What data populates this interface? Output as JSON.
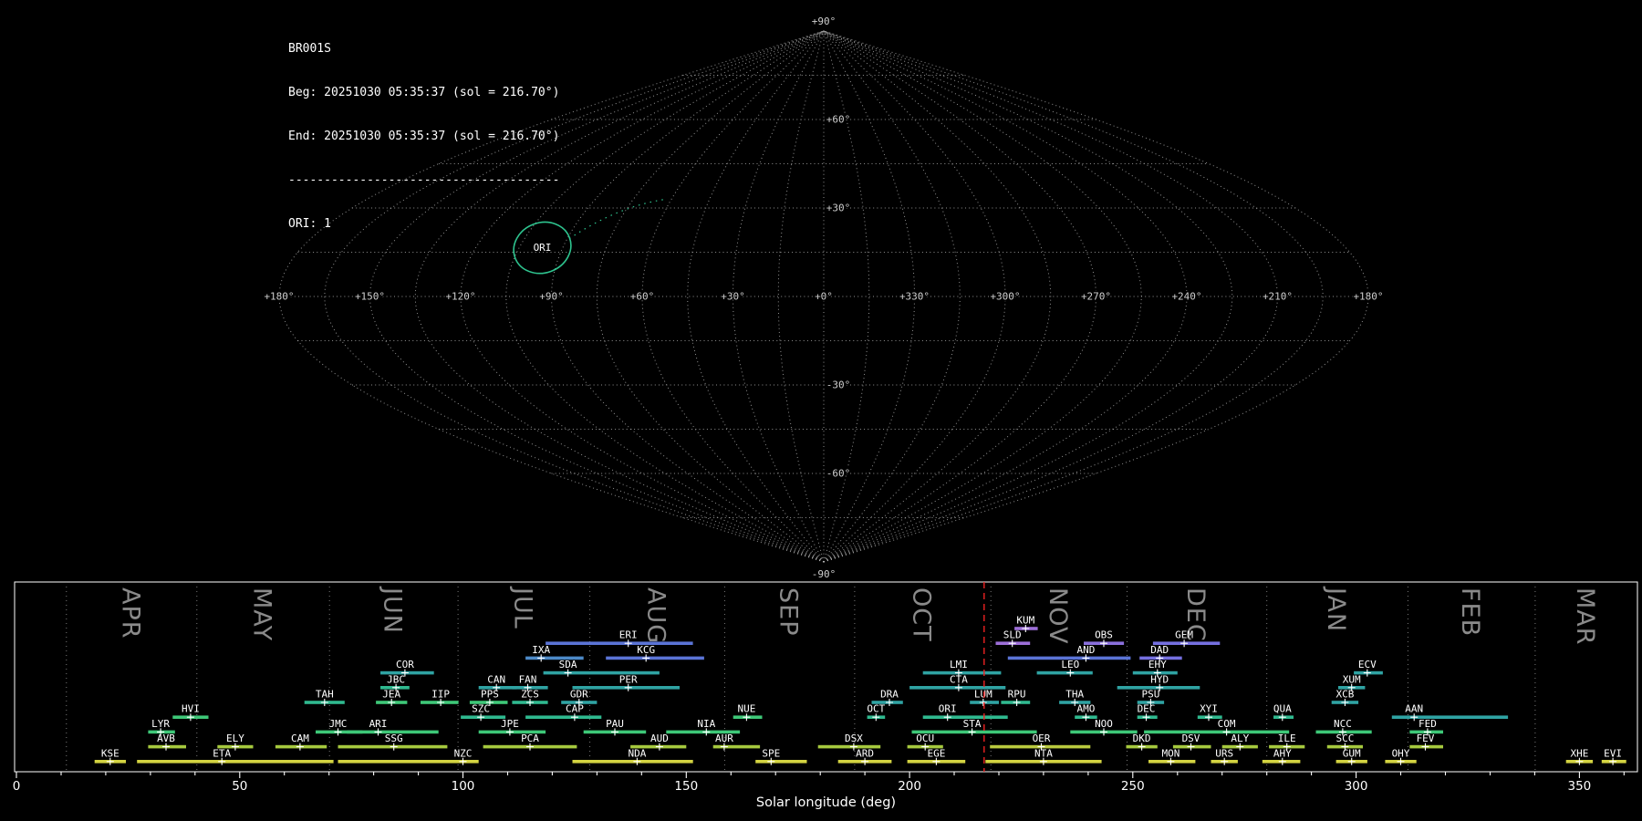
{
  "info": {
    "station": "BR001S",
    "beg_line": "Beg: 20251030 05:35:37 (sol = 216.70°)",
    "end_line": "End: 20251030 05:35:37 (sol = 216.70°)",
    "separator": "--------------------------------------",
    "counts_line": "ORI: 1"
  },
  "chart_data": [
    {
      "type": "sky_map",
      "projection": "sinusoidal",
      "grid_step_deg": 15,
      "pole_labels": {
        "top": "+90°",
        "bottom": "-90°"
      },
      "equator_labels": [
        {
          "lon": 180,
          "text": "+180°"
        },
        {
          "lon": 150,
          "text": "+150°"
        },
        {
          "lon": 120,
          "text": "+120°"
        },
        {
          "lon": 90,
          "text": "+90°"
        },
        {
          "lon": 60,
          "text": "+60°"
        },
        {
          "lon": 30,
          "text": "+30°"
        },
        {
          "lon": 0,
          "text": "+0°"
        },
        {
          "lon": -30,
          "text": "+330°"
        },
        {
          "lon": -60,
          "text": "+300°"
        },
        {
          "lon": -90,
          "text": "+270°"
        },
        {
          "lon": -120,
          "text": "+240°"
        },
        {
          "lon": -150,
          "text": "+210°"
        },
        {
          "lon": -180,
          "text": "+180°"
        }
      ],
      "latitude_labels": [
        {
          "lat": 60,
          "text": "+60°"
        },
        {
          "lat": 30,
          "text": "+30°"
        },
        {
          "lat": -30,
          "text": "-30°"
        },
        {
          "lat": -60,
          "text": "-60°"
        }
      ],
      "radiants": [
        {
          "code": "ORI",
          "lon": 97,
          "lat": 16.5,
          "rx_deg": 10,
          "ry_deg": 8.5,
          "tilt_deg": -20,
          "color": "#2ec48f",
          "drift_to": {
            "lon": 62,
            "lat": 33
          }
        }
      ]
    },
    {
      "type": "activity_timeline",
      "xlabel": "Solar longitude (deg)",
      "x_ticks": [
        0,
        50,
        100,
        150,
        200,
        250,
        300,
        350
      ],
      "x_min": 0,
      "x_max": 363,
      "current_sol": 216.7,
      "current_sol_color": "#ee2222",
      "months": [
        {
          "label": "APR",
          "start": 11.2
        },
        {
          "label": "MAY",
          "start": 40.4
        },
        {
          "label": "JUN",
          "start": 70.1
        },
        {
          "label": "JUL",
          "start": 98.9
        },
        {
          "label": "AUG",
          "start": 128.4
        },
        {
          "label": "SEP",
          "start": 158.6
        },
        {
          "label": "OCT",
          "start": 187.7
        },
        {
          "label": "NOV",
          "start": 218.2
        },
        {
          "label": "DEC",
          "start": 248.7
        },
        {
          "label": "JAN",
          "start": 280.0
        },
        {
          "label": "FEB",
          "start": 311.6
        },
        {
          "label": "MAR",
          "start": 340.1
        }
      ],
      "showers": [
        {
          "code": "KUM",
          "row": 0,
          "start": 223.5,
          "end": 228.7,
          "peak": 226,
          "color": "#9d6fd8"
        },
        {
          "code": "ERI",
          "row": 1,
          "start": 118.5,
          "end": 151.5,
          "peak": 137,
          "color": "#5b74d6"
        },
        {
          "code": "SLD",
          "row": 1,
          "start": 219.3,
          "end": 227,
          "peak": 223,
          "color": "#9d6fd8"
        },
        {
          "code": "OBS",
          "row": 1,
          "start": 239,
          "end": 248,
          "peak": 243.5,
          "color": "#8a70dc"
        },
        {
          "code": "GEM",
          "row": 1,
          "start": 254.5,
          "end": 269.5,
          "peak": 261.5,
          "color": "#7570e0"
        },
        {
          "code": "IXA",
          "row": 2,
          "start": 114,
          "end": 127,
          "peak": 117.5,
          "color": "#4d8ac8"
        },
        {
          "code": "KCG",
          "row": 2,
          "start": 132,
          "end": 154,
          "peak": 141,
          "color": "#5b74d6"
        },
        {
          "code": "AND",
          "row": 2,
          "start": 222,
          "end": 249.5,
          "peak": 239.5,
          "color": "#5b74d6"
        },
        {
          "code": "DAD",
          "row": 2,
          "start": 251.5,
          "end": 261,
          "peak": 256,
          "color": "#7570e0"
        },
        {
          "code": "COR",
          "row": 3,
          "start": 81.5,
          "end": 93.5,
          "peak": 87,
          "color": "#2fa3a3"
        },
        {
          "code": "SDA",
          "row": 3,
          "start": 118,
          "end": 144,
          "peak": 123.5,
          "color": "#2fa3a3"
        },
        {
          "code": "LMI",
          "row": 3,
          "start": 203,
          "end": 220.5,
          "peak": 211,
          "color": "#2fa3a3"
        },
        {
          "code": "LEO",
          "row": 3,
          "start": 228.5,
          "end": 241,
          "peak": 236,
          "color": "#2fa3a3"
        },
        {
          "code": "EHY",
          "row": 3,
          "start": 250,
          "end": 260,
          "peak": 255.5,
          "color": "#2fa3a3"
        },
        {
          "code": "ECV",
          "row": 3,
          "start": 299.5,
          "end": 306,
          "peak": 302.5,
          "color": "#2fa3a3"
        },
        {
          "code": "JBC",
          "row": 4,
          "start": 81.5,
          "end": 88,
          "peak": 85,
          "color": "#2fb98f"
        },
        {
          "code": "CAN",
          "row": 4,
          "start": 103.5,
          "end": 112,
          "peak": 107.5,
          "color": "#2fa3a3"
        },
        {
          "code": "FAN",
          "row": 4,
          "start": 111,
          "end": 119,
          "peak": 114.5,
          "color": "#2fa3a3"
        },
        {
          "code": "PER",
          "row": 4,
          "start": 124.5,
          "end": 148.5,
          "peak": 137,
          "color": "#2fa3a3"
        },
        {
          "code": "CTA",
          "row": 4,
          "start": 200,
          "end": 221.5,
          "peak": 211,
          "color": "#2fa3a3"
        },
        {
          "code": "HYD",
          "row": 4,
          "start": 246.5,
          "end": 265,
          "peak": 256,
          "color": "#2fa3a3"
        },
        {
          "code": "XUM",
          "row": 4,
          "start": 296,
          "end": 302,
          "peak": 299,
          "color": "#2fa3a3"
        },
        {
          "code": "TAH",
          "row": 5,
          "start": 64.5,
          "end": 73.5,
          "peak": 69,
          "color": "#2fb98f"
        },
        {
          "code": "JEA",
          "row": 5,
          "start": 80.5,
          "end": 87.5,
          "peak": 84,
          "color": "#3ec878"
        },
        {
          "code": "IIP",
          "row": 5,
          "start": 90.5,
          "end": 99,
          "peak": 95,
          "color": "#3ec878"
        },
        {
          "code": "PPS",
          "row": 5,
          "start": 101.5,
          "end": 110,
          "peak": 106,
          "color": "#3ec878"
        },
        {
          "code": "ZCS",
          "row": 5,
          "start": 111,
          "end": 119,
          "peak": 115,
          "color": "#2fb98f"
        },
        {
          "code": "GDR",
          "row": 5,
          "start": 122,
          "end": 130,
          "peak": 126,
          "color": "#2fa3a3"
        },
        {
          "code": "DRA",
          "row": 5,
          "start": 191.5,
          "end": 198.5,
          "peak": 195.5,
          "color": "#2fa3a3"
        },
        {
          "code": "LUM",
          "row": 5,
          "start": 213.5,
          "end": 220,
          "peak": 216.5,
          "color": "#2fa3a3"
        },
        {
          "code": "RPU",
          "row": 5,
          "start": 220.5,
          "end": 227,
          "peak": 224,
          "color": "#2fb98f"
        },
        {
          "code": "THA",
          "row": 5,
          "start": 233.5,
          "end": 240.5,
          "peak": 237,
          "color": "#2fa3a3"
        },
        {
          "code": "PSU",
          "row": 5,
          "start": 251,
          "end": 257,
          "peak": 254,
          "color": "#2fa3a3"
        },
        {
          "code": "XCB",
          "row": 5,
          "start": 294.5,
          "end": 300.5,
          "peak": 297.5,
          "color": "#2fa3a3"
        },
        {
          "code": "HVI",
          "row": 6,
          "start": 35,
          "end": 43,
          "peak": 39,
          "color": "#3ec878"
        },
        {
          "code": "SZC",
          "row": 6,
          "start": 99.5,
          "end": 109.5,
          "peak": 104,
          "color": "#2fb98f"
        },
        {
          "code": "CAP",
          "row": 6,
          "start": 114,
          "end": 131,
          "peak": 125,
          "color": "#2fb98f"
        },
        {
          "code": "NUE",
          "row": 6,
          "start": 160.5,
          "end": 167,
          "peak": 163.5,
          "color": "#3ec878"
        },
        {
          "code": "OCT",
          "row": 6,
          "start": 190.5,
          "end": 194.5,
          "peak": 192.5,
          "color": "#2fb98f"
        },
        {
          "code": "ORI",
          "row": 6,
          "start": 203,
          "end": 222,
          "peak": 208.5,
          "color": "#2fb98f"
        },
        {
          "code": "AMO",
          "row": 6,
          "start": 237,
          "end": 242,
          "peak": 239.5,
          "color": "#2fb98f"
        },
        {
          "code": "DEC",
          "row": 6,
          "start": 251,
          "end": 255.5,
          "peak": 253,
          "color": "#2fb98f"
        },
        {
          "code": "XYI",
          "row": 6,
          "start": 264.5,
          "end": 270,
          "peak": 267,
          "color": "#2fb98f"
        },
        {
          "code": "QUA",
          "row": 6,
          "start": 281.5,
          "end": 286,
          "peak": 283.5,
          "color": "#2fb98f"
        },
        {
          "code": "AAN",
          "row": 6,
          "start": 308,
          "end": 334,
          "peak": 313,
          "color": "#2fa3a3"
        },
        {
          "code": "LYR",
          "row": 7,
          "start": 29.5,
          "end": 35.5,
          "peak": 32.3,
          "color": "#3ec878"
        },
        {
          "code": "JMC",
          "row": 7,
          "start": 67,
          "end": 77.5,
          "peak": 72,
          "color": "#3ec878"
        },
        {
          "code": "ARI",
          "row": 7,
          "start": 74,
          "end": 94.5,
          "peak": 81,
          "color": "#3ec878"
        },
        {
          "code": "JPE",
          "row": 7,
          "start": 103.5,
          "end": 118.5,
          "peak": 110.5,
          "color": "#3ec878"
        },
        {
          "code": "PAU",
          "row": 7,
          "start": 127,
          "end": 141,
          "peak": 134,
          "color": "#3ec878"
        },
        {
          "code": "NIA",
          "row": 7,
          "start": 145.5,
          "end": 162,
          "peak": 154.5,
          "color": "#3ec878"
        },
        {
          "code": "STA",
          "row": 7,
          "start": 200.5,
          "end": 228.5,
          "peak": 214,
          "color": "#3ec878"
        },
        {
          "code": "NOO",
          "row": 7,
          "start": 236,
          "end": 251,
          "peak": 243.5,
          "color": "#3ec878"
        },
        {
          "code": "COM",
          "row": 7,
          "start": 252.5,
          "end": 285,
          "peak": 271,
          "color": "#3ec878"
        },
        {
          "code": "NCC",
          "row": 7,
          "start": 291,
          "end": 303.5,
          "peak": 297,
          "color": "#3ec878"
        },
        {
          "code": "FED",
          "row": 7,
          "start": 312,
          "end": 319.5,
          "peak": 316,
          "color": "#3ec878"
        },
        {
          "code": "AVB",
          "row": 8,
          "start": 29.5,
          "end": 38,
          "peak": 33.5,
          "color": "#a6c93e"
        },
        {
          "code": "ELY",
          "row": 8,
          "start": 45,
          "end": 53,
          "peak": 49,
          "color": "#a6c93e"
        },
        {
          "code": "CAM",
          "row": 8,
          "start": 58,
          "end": 69.5,
          "peak": 63.5,
          "color": "#a6c93e"
        },
        {
          "code": "SSG",
          "row": 8,
          "start": 72,
          "end": 96.5,
          "peak": 84.5,
          "color": "#a6c93e"
        },
        {
          "code": "PCA",
          "row": 8,
          "start": 104.5,
          "end": 125.5,
          "peak": 115,
          "color": "#a6c93e"
        },
        {
          "code": "AUD",
          "row": 8,
          "start": 137.5,
          "end": 150,
          "peak": 144,
          "color": "#a6c93e"
        },
        {
          "code": "AUR",
          "row": 8,
          "start": 156,
          "end": 166.5,
          "peak": 158.5,
          "color": "#a6c93e"
        },
        {
          "code": "DSX",
          "row": 8,
          "start": 179.5,
          "end": 193.5,
          "peak": 187.5,
          "color": "#a6c93e"
        },
        {
          "code": "OCU",
          "row": 8,
          "start": 199.5,
          "end": 207.5,
          "peak": 203.5,
          "color": "#a6c93e"
        },
        {
          "code": "OER",
          "row": 8,
          "start": 218,
          "end": 240.5,
          "peak": 229.5,
          "color": "#b9c93e"
        },
        {
          "code": "DKD",
          "row": 8,
          "start": 248.5,
          "end": 255.5,
          "peak": 252,
          "color": "#a6c93e"
        },
        {
          "code": "DSV",
          "row": 8,
          "start": 259,
          "end": 267.5,
          "peak": 263,
          "color": "#a6c93e"
        },
        {
          "code": "ALY",
          "row": 8,
          "start": 270,
          "end": 278,
          "peak": 274,
          "color": "#a6c93e"
        },
        {
          "code": "ILE",
          "row": 8,
          "start": 280.5,
          "end": 288.5,
          "peak": 284.5,
          "color": "#a6c93e"
        },
        {
          "code": "SCC",
          "row": 8,
          "start": 293.5,
          "end": 301.5,
          "peak": 297.5,
          "color": "#a6c93e"
        },
        {
          "code": "FEV",
          "row": 8,
          "start": 312,
          "end": 319.5,
          "peak": 315.5,
          "color": "#a6c93e"
        },
        {
          "code": "KSE",
          "row": 9,
          "start": 17.5,
          "end": 24.5,
          "peak": 21,
          "color": "#d3d341"
        },
        {
          "code": "ETA",
          "row": 9,
          "start": 27,
          "end": 71,
          "peak": 46,
          "color": "#d3d341"
        },
        {
          "code": "NZC",
          "row": 9,
          "start": 72,
          "end": 103.5,
          "peak": 100,
          "color": "#d3d341"
        },
        {
          "code": "NDA",
          "row": 9,
          "start": 124.5,
          "end": 151.5,
          "peak": 139,
          "color": "#d3d341"
        },
        {
          "code": "SPE",
          "row": 9,
          "start": 165.5,
          "end": 177,
          "peak": 169,
          "color": "#d3d341"
        },
        {
          "code": "ARD",
          "row": 9,
          "start": 184,
          "end": 196,
          "peak": 190,
          "color": "#d3d341"
        },
        {
          "code": "EGE",
          "row": 9,
          "start": 199.5,
          "end": 212.5,
          "peak": 206,
          "color": "#d3d341"
        },
        {
          "code": "NTA",
          "row": 9,
          "start": 217,
          "end": 243,
          "peak": 230,
          "color": "#d3d341"
        },
        {
          "code": "MON",
          "row": 9,
          "start": 253.5,
          "end": 264,
          "peak": 258.5,
          "color": "#d3d341"
        },
        {
          "code": "URS",
          "row": 9,
          "start": 267.5,
          "end": 273.5,
          "peak": 270.5,
          "color": "#d3d341"
        },
        {
          "code": "AHY",
          "row": 9,
          "start": 279,
          "end": 287.5,
          "peak": 283.5,
          "color": "#d3d341"
        },
        {
          "code": "GUM",
          "row": 9,
          "start": 295.5,
          "end": 302.5,
          "peak": 299,
          "color": "#d3d341"
        },
        {
          "code": "OHY",
          "row": 9,
          "start": 306.5,
          "end": 313.5,
          "peak": 310,
          "color": "#d3d341"
        },
        {
          "code": "XHE",
          "row": 9,
          "start": 347,
          "end": 353,
          "peak": 350,
          "color": "#d3d341"
        },
        {
          "code": "EVI",
          "row": 9,
          "start": 355,
          "end": 360.5,
          "peak": 357.5,
          "color": "#d3d341"
        }
      ]
    }
  ]
}
